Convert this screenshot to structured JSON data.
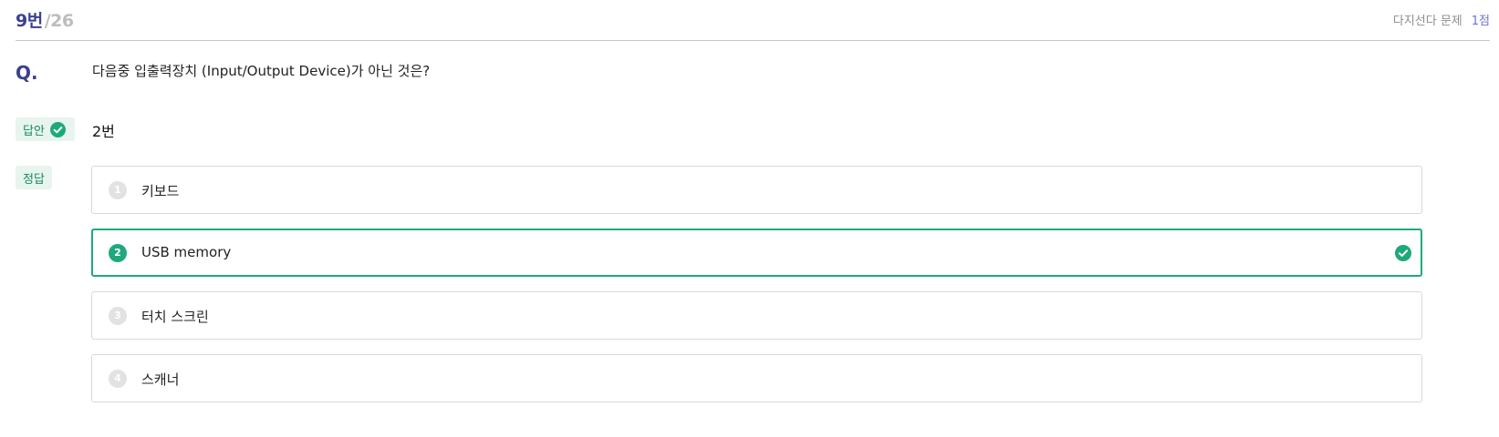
{
  "header": {
    "current": "9번",
    "total": "/26",
    "type": "다지선다 문제",
    "score": "1점"
  },
  "question": {
    "label": "Q.",
    "text": "다음중 입출력장치 (Input/Output Device)가 아닌 것은?"
  },
  "answer": {
    "badge_label": "답안",
    "value": "2번"
  },
  "correct": {
    "badge_label": "정답"
  },
  "options": [
    {
      "num": "1",
      "text": "키보드",
      "selected": false
    },
    {
      "num": "2",
      "text": "USB memory",
      "selected": true
    },
    {
      "num": "3",
      "text": "터치 스크린",
      "selected": false
    },
    {
      "num": "4",
      "text": "스캐너",
      "selected": false
    }
  ],
  "colors": {
    "accent": "#3b4190",
    "correct_green": "#1ea97c",
    "badge_bg": "#e7f5ee",
    "score_blue": "#6b73d6"
  },
  "icons": {
    "answer_badge": "check-circle-icon",
    "selected_option": "check-circle-icon"
  }
}
